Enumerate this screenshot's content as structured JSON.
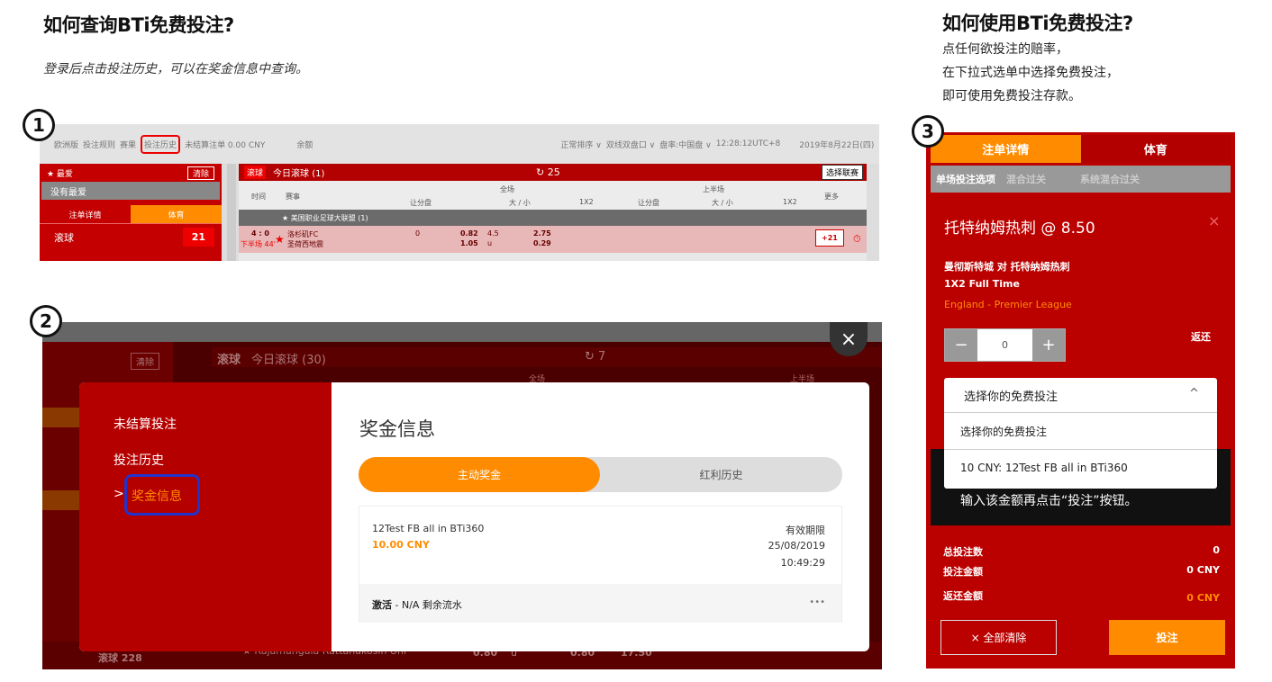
{
  "left_heading": "如何查询BTi免费投注?",
  "left_subtitle": "登录后点击投注历史，可以在奖金信息中查询。",
  "right_heading": "如何使用BTi免费投注?",
  "right_lines": [
    "点任何欲投注的赔率，",
    "在下拉式选单中选择免费投注，",
    "即可使用免费投注存款。"
  ],
  "steps": [
    "1",
    "2",
    "3"
  ],
  "shot1": {
    "nav": [
      "欧洲版",
      "投注规则",
      "赛果",
      "投注历史",
      "未结算注单 0.00 CNY",
      "余额"
    ],
    "nav_right": [
      "正常排序 ∨",
      "双线双盘口 ∨",
      "盘率:中国盘 ∨",
      "12:28:12UTC+8",
      "2019年8月22日(四)"
    ],
    "fav": "★ 最爱",
    "clear": "清除",
    "no_fav": "没有最爱",
    "tab1": "注单详情",
    "tab2": "体育",
    "live": "滚球",
    "live_count": "21",
    "live_badge": "滚球",
    "live_title": "今日滚球 (1)",
    "refresh": "25",
    "select_league": "选择联赛",
    "col_time": "时间",
    "col_match": "赛事",
    "col_full": "全场",
    "col_half": "上半场",
    "col_more": "更多",
    "sub_cols": [
      "让分盘",
      "大 / 小",
      "1X2",
      "让分盘",
      "大 / 小",
      "1X2"
    ],
    "league": "★ 美国职业足球大联盟 (1)",
    "score": "4 : 0",
    "minute": "下半场 44'",
    "team1": "洛杉矶FC",
    "team2": "圣荷西地震",
    "odds": [
      "0",
      "0.82",
      "4.5",
      "2.75",
      "1.05",
      "u",
      "0.29"
    ],
    "more": "+21"
  },
  "shot2": {
    "bg_clear": "清除",
    "bg_live": "滚球",
    "bg_title": "今日滚球 (30)",
    "bg_refresh": "7",
    "bg_full": "全场",
    "bg_half": "上半场",
    "bg_row": "滚球   228",
    "bg_team": "★ Rajamangala Rattanakosin Uni",
    "bg_odds": [
      "0.80",
      "u",
      "0.80",
      "17.50"
    ],
    "menu": [
      "未结算投注",
      "投注历史",
      "奖金信息"
    ],
    "close": "×",
    "title": "奖金信息",
    "tab_active": "主动奖金",
    "tab_other": "红利历史",
    "bonus_name": "12Test FB all in BTi360",
    "bonus_amount": "10.00 CNY",
    "expiry_label": "有效期限",
    "expiry_date": "25/08/2019",
    "expiry_time": "10:49:29",
    "activate": "激活",
    "activate_rest": " - N/A 剩余流水",
    "dots": "•••"
  },
  "shot3": {
    "tab1": "注单详情",
    "tab2": "体育",
    "sub_tabs": [
      "单场投注选项",
      "混合过关",
      "系统混合过关"
    ],
    "selection": "托特纳姆热刺 @ 8.50",
    "close": "×",
    "match": "曼彻斯特城  对  托特纳姆热刺",
    "market": "1X2 Full Time",
    "league": "England - Premier League",
    "minus": "−",
    "stake": "0",
    "plus": "+",
    "return_label": "返还",
    "dropdown_label": "选择你的免费投注",
    "dropdown_chevron": "^",
    "options": [
      "选择你的免费投注",
      "10 CNY: 12Test FB all in BTi360"
    ],
    "hint": "输入该金额再点击“投注”按钮。",
    "totals": [
      {
        "label": "总投注数",
        "value": "0"
      },
      {
        "label": "投注金额",
        "value": "0 CNY"
      },
      {
        "label": "返还金额",
        "value": "0 CNY"
      }
    ],
    "clear_all": "× 全部清除",
    "bet": "投注"
  },
  "colors": {
    "red": "#bb0000",
    "orange": "#ff8c00",
    "blue_highlight": "#2233cc"
  }
}
